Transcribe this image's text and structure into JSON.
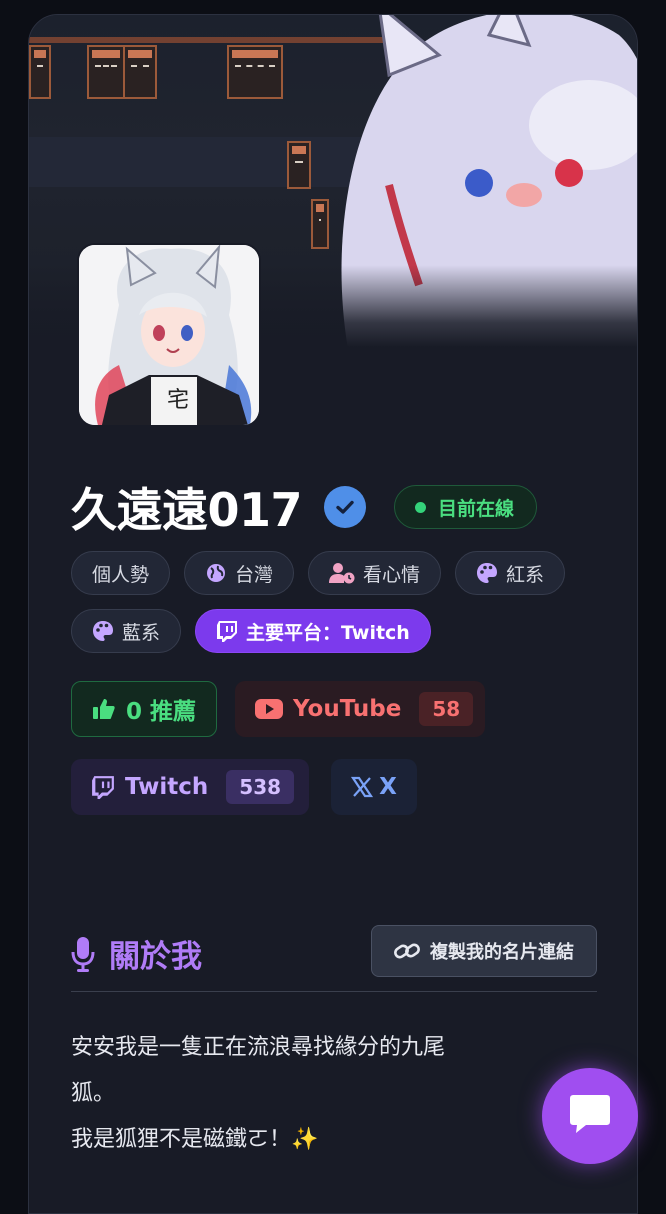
{
  "profile": {
    "name": "久遠遠017",
    "status": "目前在線"
  },
  "tags": [
    {
      "label": "個人勢",
      "icon": null
    },
    {
      "label": "台灣",
      "icon": "globe-icon"
    },
    {
      "label": "看心情",
      "icon": "user-clock-icon"
    },
    {
      "label": "紅系",
      "icon": "palette-icon"
    },
    {
      "label": "藍系",
      "icon": "palette-icon"
    }
  ],
  "platform_tag": "主要平台：Twitch",
  "buttons": {
    "recommend": "0 推薦",
    "youtube": {
      "label": "YouTube",
      "count": "58"
    },
    "twitch": {
      "label": "Twitch",
      "count": "538"
    },
    "x": {
      "label": "X"
    }
  },
  "about": {
    "title": "關於我",
    "copy_label": "複製我的名片連結",
    "line1": "安安我是一隻正在流浪尋找緣分的九尾",
    "line2": "狐。",
    "line3": "我是狐狸不是磁鐵ㄛ！✨"
  },
  "colors": {
    "accent": "#7c3aed",
    "online": "#4ade80",
    "youtube": "#f87171",
    "twitch": "#c4a6ff",
    "x": "#7aa2f7"
  }
}
